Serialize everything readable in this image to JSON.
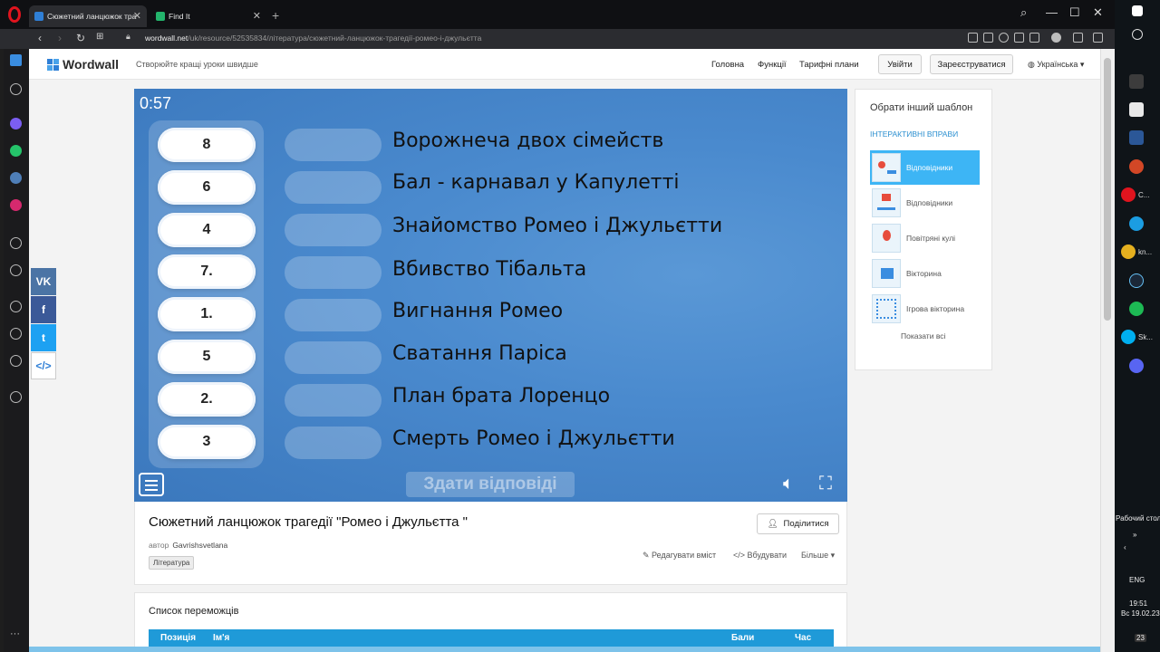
{
  "browser": {
    "tabs": [
      {
        "title": "Сюжетний ланцюжок трa",
        "active": true
      },
      {
        "title": "Find It",
        "active": false
      }
    ],
    "url_host": "wordwall.net",
    "url_path": "/uk/resource/52535834/література/сюжетний-ланцюжок-трагедії-ромео-і-джульєтта"
  },
  "header": {
    "logo": "Wordwall",
    "tagline": "Створюйте кращі уроки швидше",
    "nav": [
      "Головна",
      "Функції",
      "Тарифні плани"
    ],
    "login": "Увійти",
    "register": "Зареєструватися",
    "language": "Українська"
  },
  "share": {
    "vk": "VK",
    "fb": "f",
    "tw": "t",
    "embed": "</>"
  },
  "game": {
    "timer": "0:57",
    "numbers": [
      "8",
      "6",
      "4",
      "7.",
      "1.",
      "5",
      "2.",
      "3"
    ],
    "events": [
      "Ворожнеча двох сімейств",
      "Бал - карнавал у Капулетті",
      "Знайомство Ромео і Джульєтти",
      "Вбивство Тібальта",
      "Вигнання Ромео",
      "Сватання Паріса",
      "План брата Лоренцо",
      "Смерть Ромео і Джульєтти"
    ],
    "submit": "Здати відповіді"
  },
  "templates": {
    "title": "Обрати інший шаблон",
    "subtitle": "ІНТЕРАКТИВНІ ВПРАВИ",
    "items": [
      "Відповідники",
      "Відповідники",
      "Повітряні кулі",
      "Вікторина",
      "Ігрова вікторина"
    ],
    "show_all": "Показати всі"
  },
  "resource": {
    "title": "Сюжетний ланцюжок трагедії \"Ромео і Джульєтта \"",
    "author_label": "автор",
    "author": "Gavrishsvetlana",
    "tag": "Література",
    "share": "Поділитися",
    "edit": "Редагувати вміст",
    "embed": "Вбудувати",
    "more": "Більше"
  },
  "leaderboard": {
    "title": "Список переможців",
    "columns": [
      "Позиція",
      "Ім'я",
      "Бали",
      "Час"
    ]
  },
  "taskbar": {
    "apps": [
      "C...",
      "kn...",
      "Sk..."
    ],
    "desktop": "Рабочий стол",
    "lang": "ENG",
    "time": "19:51",
    "date": "Вс 19.02.23",
    "notif": "23"
  },
  "colors": {
    "game_bg": "#4a8ace",
    "accent": "#3db5f5",
    "leader_head": "#1f9ad8"
  }
}
